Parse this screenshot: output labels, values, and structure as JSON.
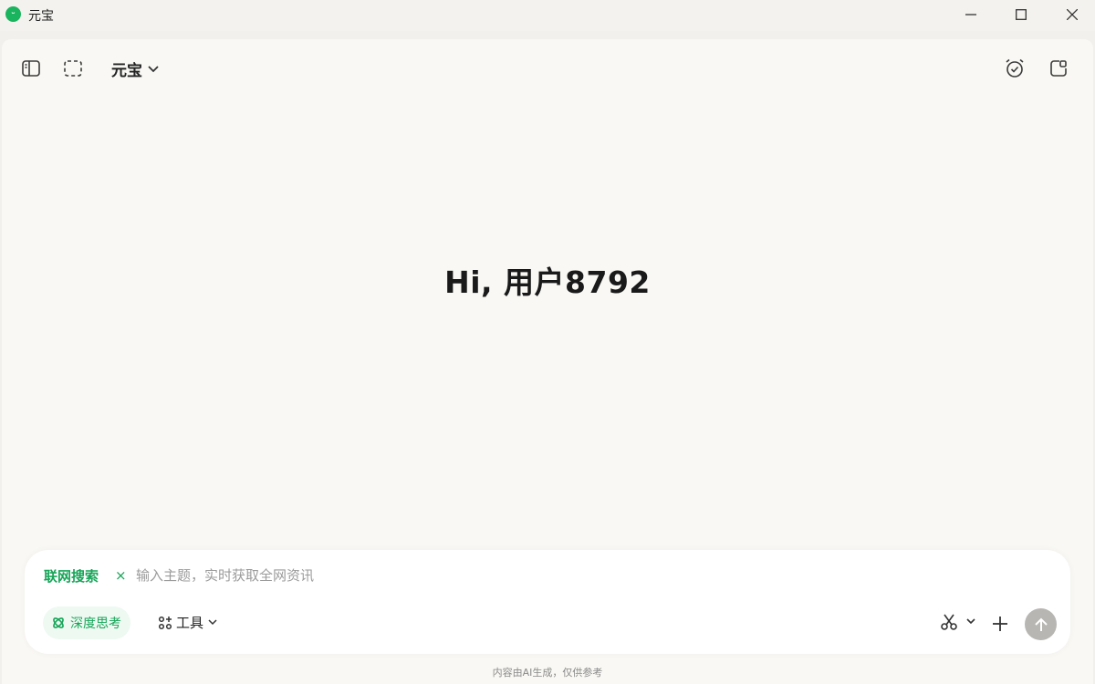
{
  "window": {
    "title": "元宝",
    "logo_text": "ᵕ",
    "icons": [
      "minimize-icon",
      "maximize-icon",
      "close-icon"
    ]
  },
  "header": {
    "model_name": "元宝",
    "left_icons": [
      "sidebar-toggle-icon",
      "select-area-icon"
    ],
    "right_icons": [
      "alarm-check-icon",
      "new-chat-icon"
    ]
  },
  "greeting": "Hi, 用户8792",
  "input": {
    "search_chip": "联网搜索",
    "chip_close": "×",
    "placeholder": "输入主题，实时获取全网资讯",
    "value": "",
    "deep_think_label": "深度思考",
    "tools_label": "工具"
  },
  "footer": {
    "disclaimer": "内容由AI生成，仅供参考"
  },
  "colors": {
    "accent": "#17a558",
    "background": "#f9f8f4",
    "send_disabled": "#b8b6b2"
  }
}
